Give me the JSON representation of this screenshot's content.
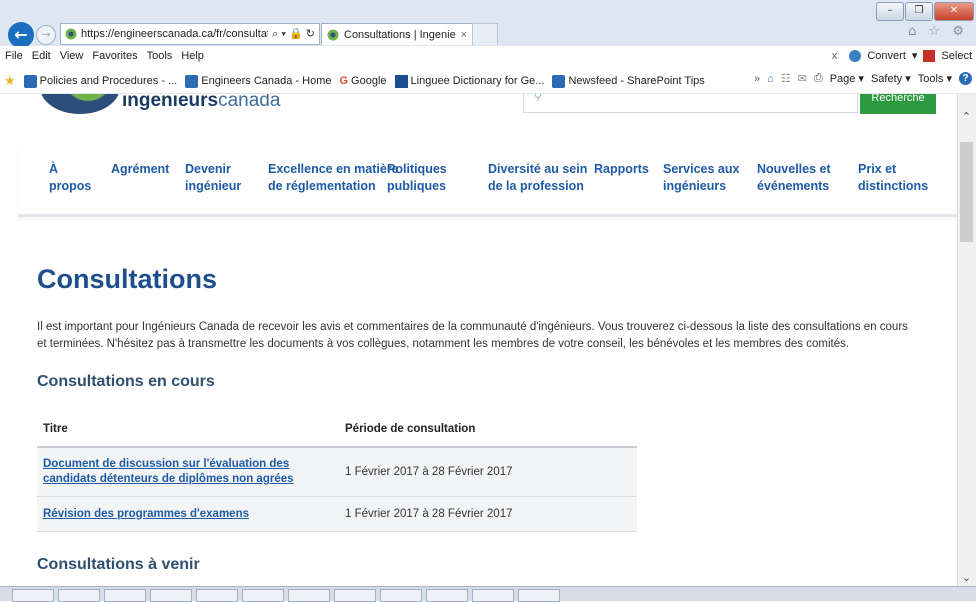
{
  "browser": {
    "url": "https://engineerscanada.ca/fr/consultations",
    "address_tools": "⌕ ▾ 🔒 ↻",
    "tab_title": "Consultations | Ingenieurs ...",
    "tab_close": "×",
    "window_buttons": {
      "minimize": "–",
      "restore": "❐",
      "close": "✕"
    },
    "top_right_icons": "⌂ ☆ ⚙",
    "menu": [
      "File",
      "Edit",
      "View",
      "Favorites",
      "Tools",
      "Help"
    ],
    "menu_right": {
      "close": "x",
      "convert": "Convert",
      "select": "Select"
    },
    "favorites": [
      "Policies and Procedures - ...",
      "Engineers Canada - Home",
      "Google",
      "Linguee Dictionary for Ge...",
      "Newsfeed - SharePoint Tips"
    ],
    "favbar_right": {
      "more": "»",
      "page": "Page ▾",
      "safety": "Safety ▾",
      "tools": "Tools ▾",
      "help": "?"
    }
  },
  "site": {
    "brand_bold": "ingenieurs",
    "brand_light": "canada",
    "search_button": "Recherche",
    "nav": [
      "À\npropos",
      "Agrément",
      "Devenir\ningénieur",
      "Excellence en matière\nde réglementation",
      "Politiques\npubliques",
      "Diversité au sein\nde la profession",
      "Rapports",
      "Services aux\ningénieurs",
      "Nouvelles et\névénements",
      "Prix et\ndistinctions"
    ]
  },
  "main": {
    "title": "Consultations",
    "intro": "Il est important pour Ingénieurs Canada de recevoir les avis et commentaires de la communauté d'ingénieurs. Vous trouverez ci-dessous la liste des consultations en cours et terminées. N'hésitez pas à transmettre les documents à vos collègues, notamment les membres de votre conseil, les bénévoles et les membres des comités.",
    "current_heading": "Consultations en cours",
    "table": {
      "headers": [
        "Titre",
        "Période de consultation"
      ],
      "rows": [
        {
          "title": "Document de discussion sur l'évaluation des candidats détenteurs de diplômes non agrées",
          "period": "1 Février 2017 à 28 Février 2017"
        },
        {
          "title": "Révision des programmes d'examens",
          "period": "1 Février 2017 à 28 Février 2017"
        }
      ]
    },
    "upcoming_heading": "Consultations à venir"
  }
}
